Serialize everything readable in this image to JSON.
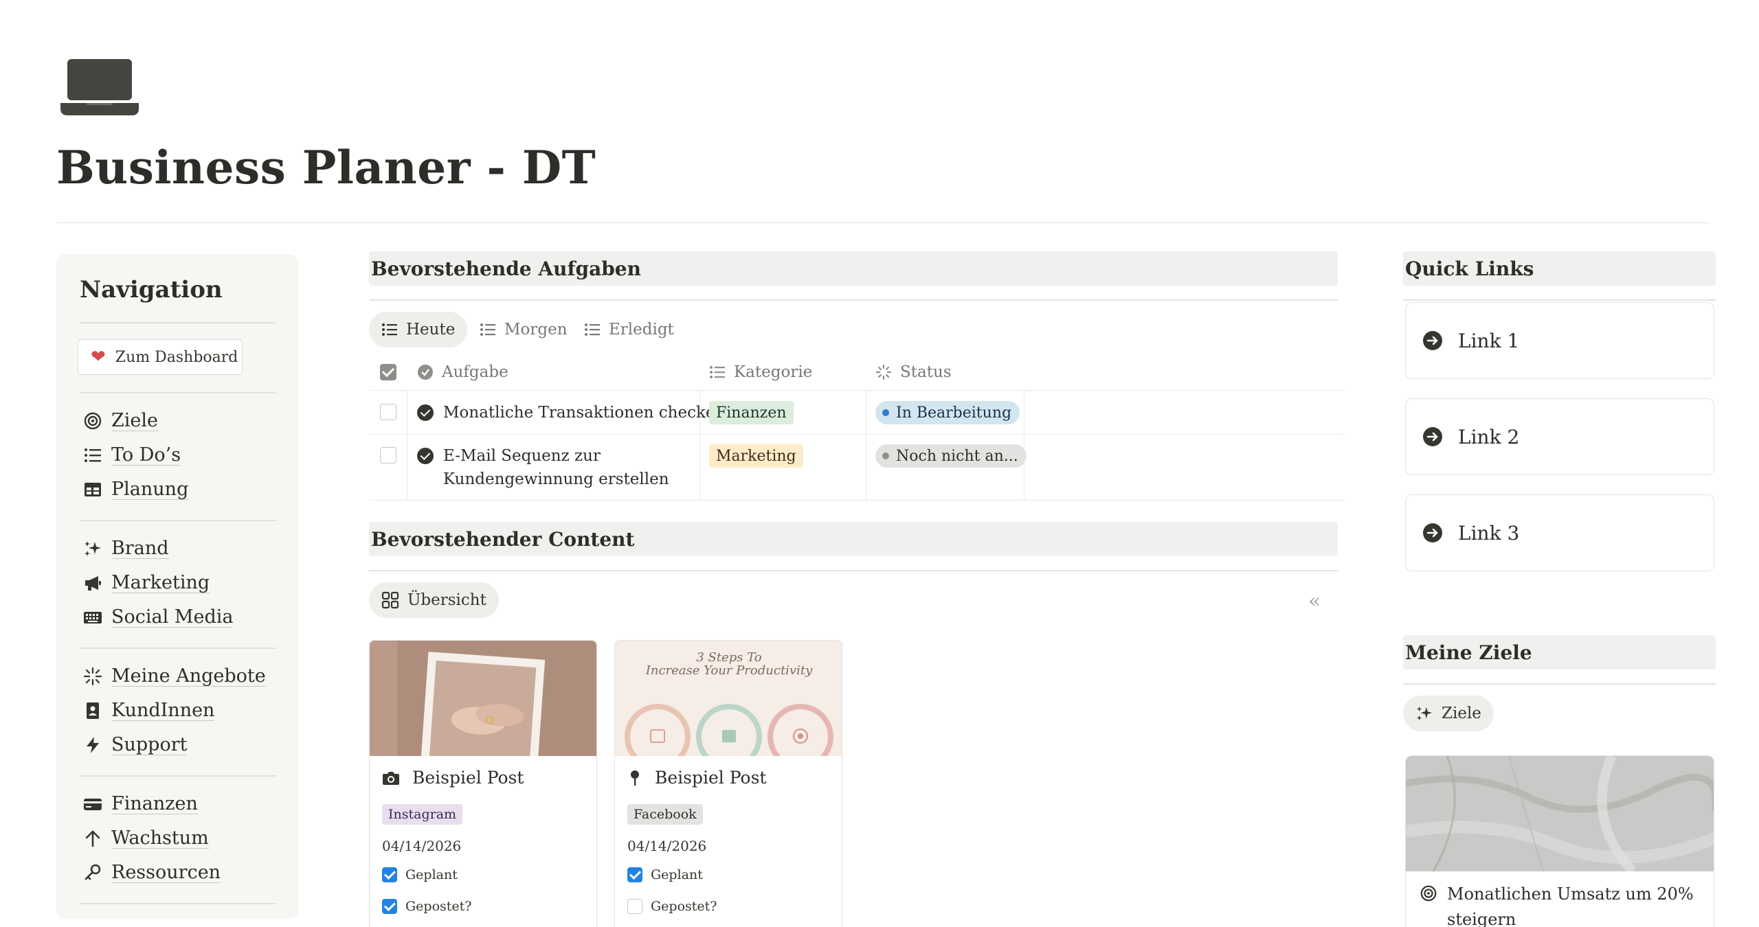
{
  "page": {
    "title": "Business Planer - DT",
    "icon": "laptop-icon"
  },
  "navigation": {
    "title": "Navigation",
    "dashboard_button": "Zum Dashboard",
    "groups": [
      [
        {
          "label": "Ziele",
          "icon": "target-icon"
        },
        {
          "label": "To Do’s",
          "icon": "list-icon"
        },
        {
          "label": "Planung",
          "icon": "table-icon"
        }
      ],
      [
        {
          "label": "Brand",
          "icon": "sparkles-icon"
        },
        {
          "label": "Marketing",
          "icon": "megaphone-icon"
        },
        {
          "label": "Social Media",
          "icon": "keyboard-icon"
        }
      ],
      [
        {
          "label": "Meine Angebote",
          "icon": "sparkle-burst-icon"
        },
        {
          "label": "KundInnen",
          "icon": "contact-book-icon"
        },
        {
          "label": "Support",
          "icon": "lightning-icon"
        }
      ],
      [
        {
          "label": "Finanzen",
          "icon": "credit-card-icon"
        },
        {
          "label": "Wachstum",
          "icon": "arrow-up-icon"
        },
        {
          "label": "Ressourcen",
          "icon": "key-icon"
        }
      ]
    ]
  },
  "tasks": {
    "header": "Bevorstehende Aufgaben",
    "tabs": [
      "Heute",
      "Morgen",
      "Erledigt"
    ],
    "columns": {
      "task": "Aufgabe",
      "category": "Kategorie",
      "status": "Status"
    },
    "rows": [
      {
        "done": false,
        "task": "Monatliche Transaktionen checken",
        "category": "Finanzen",
        "status": "In Bearbeitung"
      },
      {
        "done": false,
        "task_line1": "E-Mail Sequenz zur",
        "task_line2": "Kundengewinnung erstellen",
        "category": "Marketing",
        "status": "Noch nicht an..."
      }
    ]
  },
  "content": {
    "header": "Bevorstehender Content",
    "view": "Übersicht",
    "cards": [
      {
        "title": "Beispiel Post",
        "icon": "camera-icon",
        "platform": "Instagram",
        "date": "04/14/2026",
        "planned_label": "Geplant",
        "planned": true,
        "posted_label": "Gepostet?",
        "posted": true
      },
      {
        "title": "Beispiel Post",
        "icon": "pushpin-icon",
        "platform": "Facebook",
        "date": "04/14/2026",
        "planned_label": "Geplant",
        "planned": true,
        "posted_label": "Gepostet?",
        "posted": false,
        "image_text_line1": "3 Steps To",
        "image_text_line2": "Increase Your Productivity"
      }
    ]
  },
  "quick_links": {
    "header": "Quick Links",
    "links": [
      "Link 1",
      "Link 2",
      "Link 3"
    ]
  },
  "goals": {
    "header": "Meine Ziele",
    "button": "Ziele",
    "goal_line1": "Monatlichen Umsatz um 20%",
    "goal_line2": "steigern"
  },
  "colors": {
    "accent_blue": "#2383e2",
    "tag_finanzen_bg": "#dbeddb",
    "tag_marketing_bg": "#fdecc8",
    "status_in_progress_bg": "#d3e5ef",
    "status_not_started_bg": "#e3e2e0",
    "tag_instagram_bg": "#e8deee",
    "tag_facebook_bg": "#e3e2e0"
  }
}
